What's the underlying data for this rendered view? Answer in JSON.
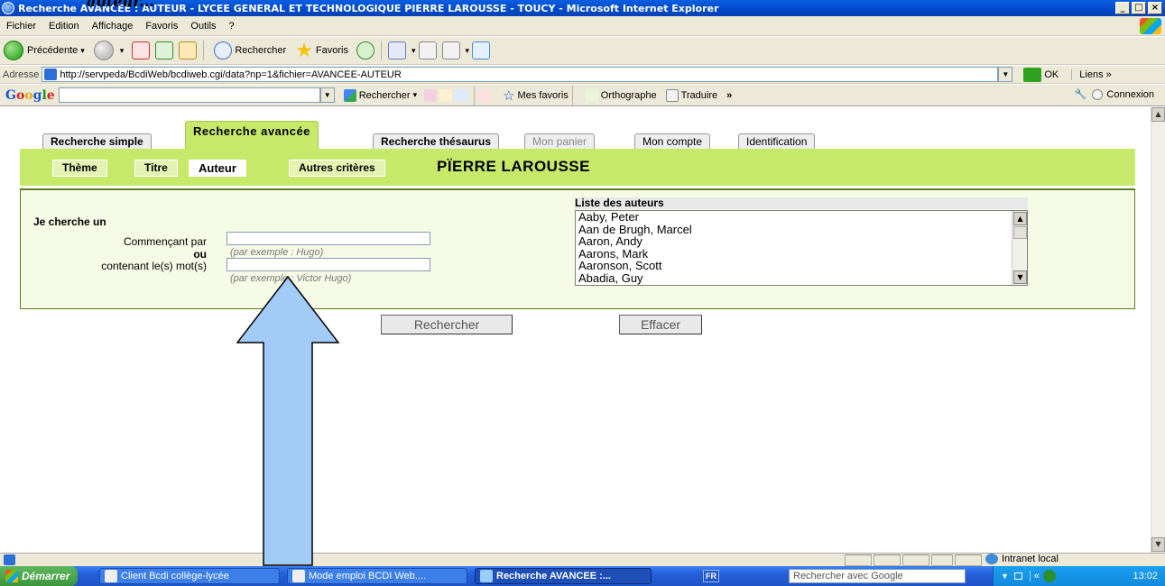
{
  "document_fragment": "auteur...",
  "window": {
    "title": "Recherche AVANCEE : AUTEUR - LYCEE GENERAL ET TECHNOLOGIQUE PIERRE LAROUSSE - TOUCY - Microsoft Internet Explorer",
    "controls": {
      "minimize": "_",
      "maximize": "□",
      "close": "×"
    }
  },
  "menu": [
    "Fichier",
    "Edition",
    "Affichage",
    "Favoris",
    "Outils",
    "?"
  ],
  "toolbar": {
    "back": "Précédente",
    "search": "Rechercher",
    "favorites": "Favoris"
  },
  "address": {
    "label": "Adresse",
    "url": "http://servpeda/BcdiWeb/bcdiweb.cgi/data?np=1&fichier=AVANCEE-AUTEUR",
    "go": "OK",
    "links": "Liens"
  },
  "google_bar": {
    "logo": [
      "G",
      "o",
      "o",
      "g",
      "l",
      "e"
    ],
    "search": "Rechercher",
    "favorites": "Mes favoris",
    "spelling": "Orthographe",
    "translate": "Traduire",
    "connexion": "Connexion"
  },
  "tabs": [
    {
      "label": "Recherche simple",
      "state": "normal"
    },
    {
      "label": "Recherche avancée",
      "state": "active"
    },
    {
      "label": "Recherche thésaurus",
      "state": "normal"
    },
    {
      "label": "Mon panier",
      "state": "disabled"
    },
    {
      "label": "Mon compte",
      "state": "normal"
    },
    {
      "label": "Identification",
      "state": "normal"
    }
  ],
  "subtabs": [
    {
      "label": "Thème"
    },
    {
      "label": "Titre"
    },
    {
      "label": "Auteur"
    },
    {
      "label": "Autres critères"
    }
  ],
  "band_title": "PÏERRE LAROUSSE",
  "form": {
    "heading": "Je cherche un",
    "starts_with_label": "Commençant par",
    "or_label": "ou",
    "contains_label": "contenant le(s) mot(s)",
    "starts_with_hint": "(par exemple : Hugo)",
    "contains_hint": "(par exemple : Victor Hugo)",
    "starts_with_value": "",
    "contains_value": ""
  },
  "author_list": {
    "title": "Liste des auteurs",
    "items": [
      "Aaby, Peter",
      "Aan de Brugh, Marcel",
      "Aaron, Andy",
      "Aarons, Mark",
      "Aaronson, Scott",
      "Abadia, Guy"
    ]
  },
  "buttons": {
    "search": "Rechercher",
    "clear": "Effacer"
  },
  "status": {
    "zone": "Intranet local"
  },
  "taskbar": {
    "start": "Démarrer",
    "items": [
      {
        "label": "Client Bcdi collège-lycée",
        "active": false
      },
      {
        "label": "Mode emploi BCDI Web....",
        "active": false
      },
      {
        "label": "Recherche AVANCEE :...",
        "active": true
      }
    ],
    "lang": "FR",
    "search_placeholder": "Rechercher avec Google",
    "clock": "13:02"
  },
  "colors": {
    "band": "#c7e96a",
    "panel": "#f6fbe6",
    "arrow": "#a3cbf7"
  }
}
